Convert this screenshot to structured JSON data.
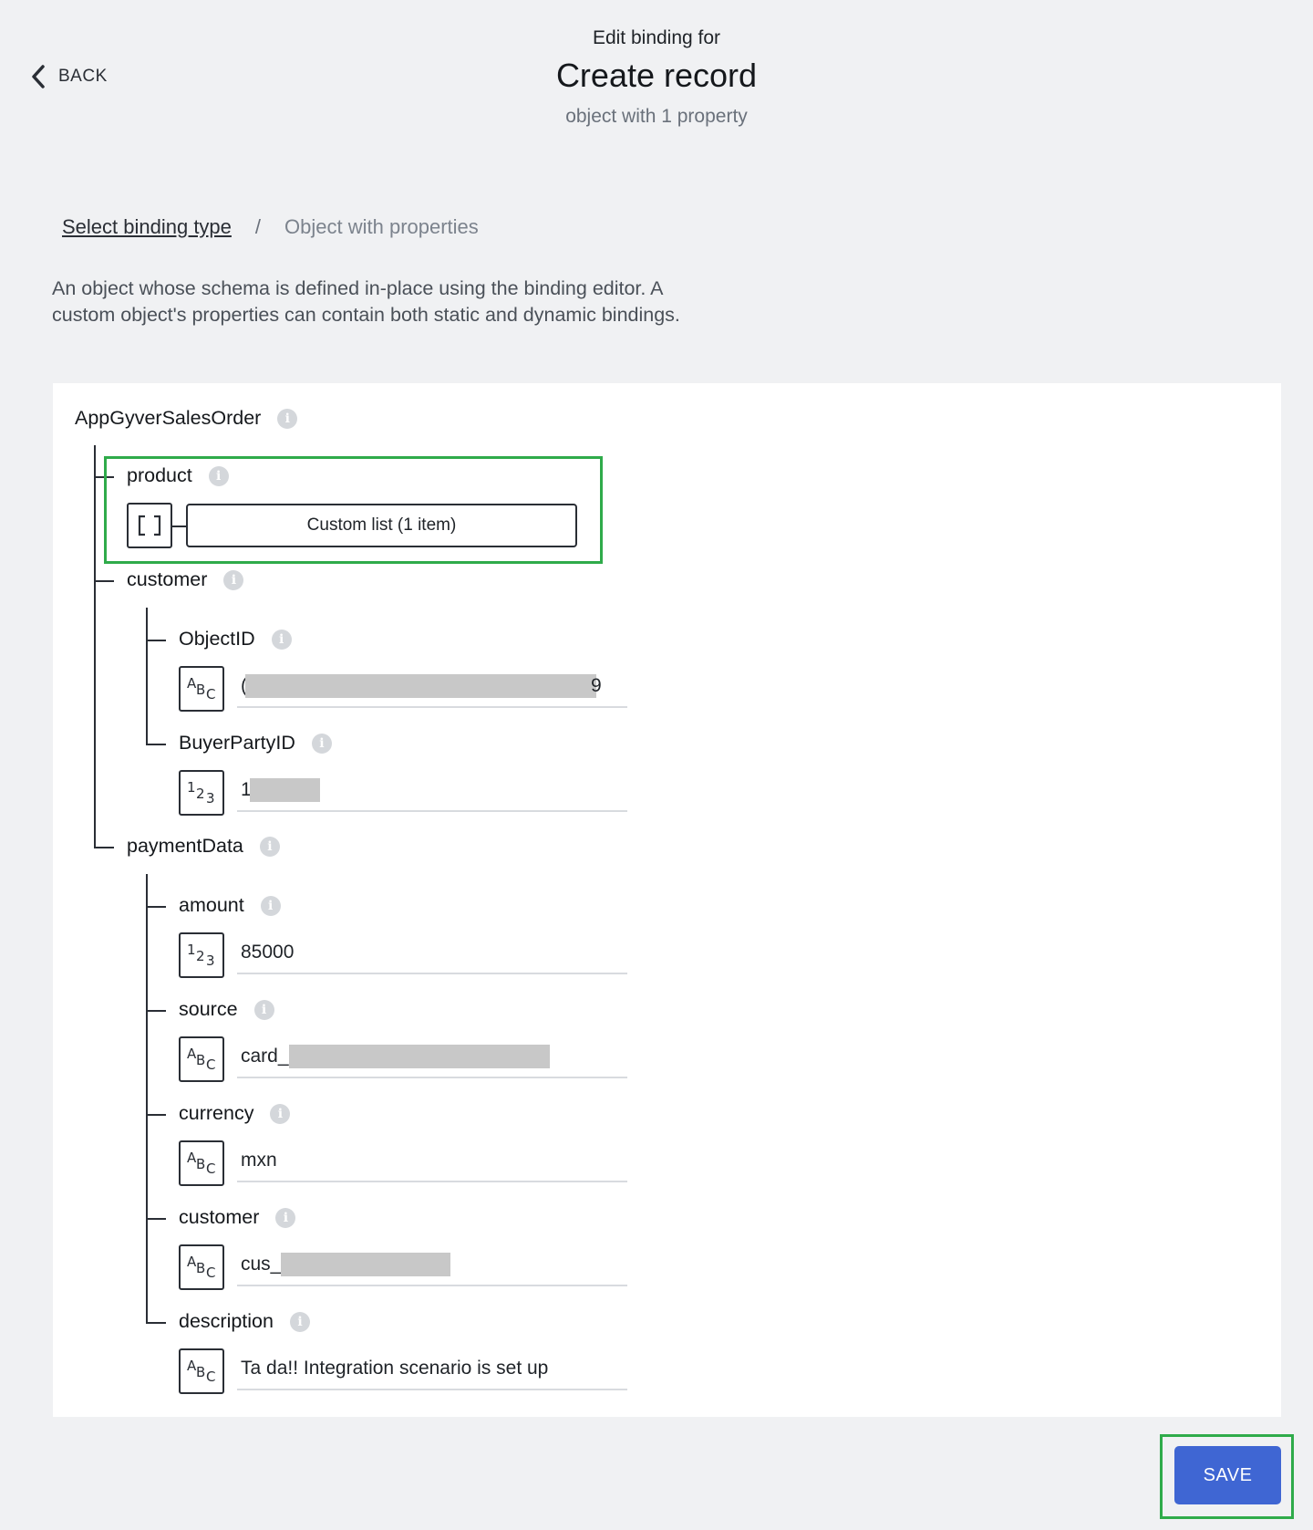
{
  "nav": {
    "back_label": "BACK"
  },
  "header": {
    "pre_title": "Edit binding for",
    "title": "Create record",
    "subtitle": "object with 1 property"
  },
  "breadcrumb": {
    "link": "Select binding type",
    "separator": "/",
    "current": "Object with properties"
  },
  "description": "An object whose schema is defined in-place using the binding editor. A custom object's properties can contain both static and dynamic bindings.",
  "tree": {
    "root_label": "AppGyverSalesOrder",
    "product": {
      "label": "product",
      "type_icon": "list-brackets-icon",
      "value": "Custom list (1 item)"
    },
    "customer": {
      "label": "customer",
      "object_id": {
        "label": "ObjectID",
        "type": "text",
        "value_prefix": "(",
        "value_suffix": "9"
      },
      "buyer_party_id": {
        "label": "BuyerPartyID",
        "type": "number",
        "value_prefix": "1"
      }
    },
    "payment_data": {
      "label": "paymentData",
      "amount": {
        "label": "amount",
        "type": "number",
        "value": "85000"
      },
      "source": {
        "label": "source",
        "type": "text",
        "value_prefix": "card_"
      },
      "currency": {
        "label": "currency",
        "type": "text",
        "value": "mxn"
      },
      "customer": {
        "label": "customer",
        "type": "text",
        "value_prefix": "cus_"
      },
      "description": {
        "label": "description",
        "type": "text",
        "value": "Ta da!! Integration scenario is set up"
      }
    }
  },
  "type_glyphs": {
    "text": [
      "A",
      "B",
      "C"
    ],
    "number": [
      "1",
      "2",
      "3"
    ]
  },
  "info_glyph": "i",
  "actions": {
    "save_label": "SAVE"
  },
  "colors": {
    "accent": "#3f66d3",
    "highlight": "#2fab4a",
    "background": "#f0f1f3"
  }
}
